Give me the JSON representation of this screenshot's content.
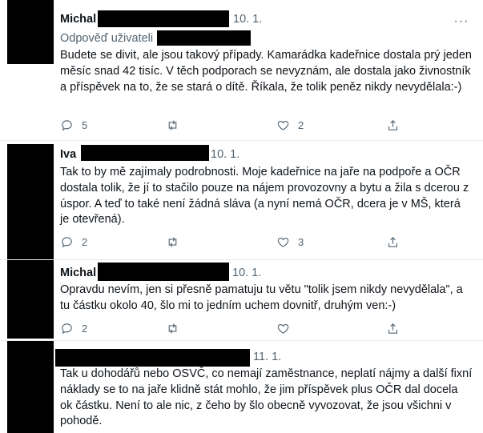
{
  "tweets": [
    {
      "name": "Michal",
      "date": "10. 1.",
      "replying_to": "Odpověď uživateli",
      "text": "Budete se divit, ale jsou takový případy. Kamarádka kadeřnice dostala prý jeden měsíc snad 42 tisíc. V těch podporach se nevyznám, ale dostala jako živnostník a příspěvek na to, že se stará o dítě. Říkala, že tolik peněz nikdy nevydělala:-)",
      "reply_count": "5",
      "retweet_count": "",
      "like_count": "2"
    },
    {
      "name": "Iva",
      "date": "10. 1.",
      "text": "Tak to by mě zajímaly podrobnosti. Moje kadeřnice na jaře na podpoře a OČR dostala tolik, že jí to stačilo pouze na nájem provozovny a bytu a žila s dcerou z úspor. A teď to také není žádná sláva (a nyní nemá OČR, dcera je v MŠ, která je otevřená).",
      "reply_count": "2",
      "retweet_count": "",
      "like_count": "3"
    },
    {
      "name": "Michal",
      "date": "10. 1.",
      "text": "Opravdu nevím, jen si přesně pamatuju tu větu \"tolik jsem nikdy nevydělala\", a tu částku okolo 40, šlo mi to jedním uchem dovnitř, druhým ven:-)",
      "reply_count": "2",
      "retweet_count": "",
      "like_count": ""
    },
    {
      "name": "",
      "date": "11. 1.",
      "text": "Tak u dohodářů nebo OSVČ, co nemají zaměstnance, neplatí nájmy a další fixní náklady se to na jaře klidně stát mohlo, že jim příspěvek plus OČR dal docela ok částku. Není to ale nic, z čeho by šlo obecně vyvozovat, že jsou všichni v pohodě."
    }
  ],
  "more_icon": "···",
  "colors": {
    "muted": "#536471",
    "text": "#0f1419",
    "divider": "#e6ecf0",
    "redaction": "#000000"
  }
}
